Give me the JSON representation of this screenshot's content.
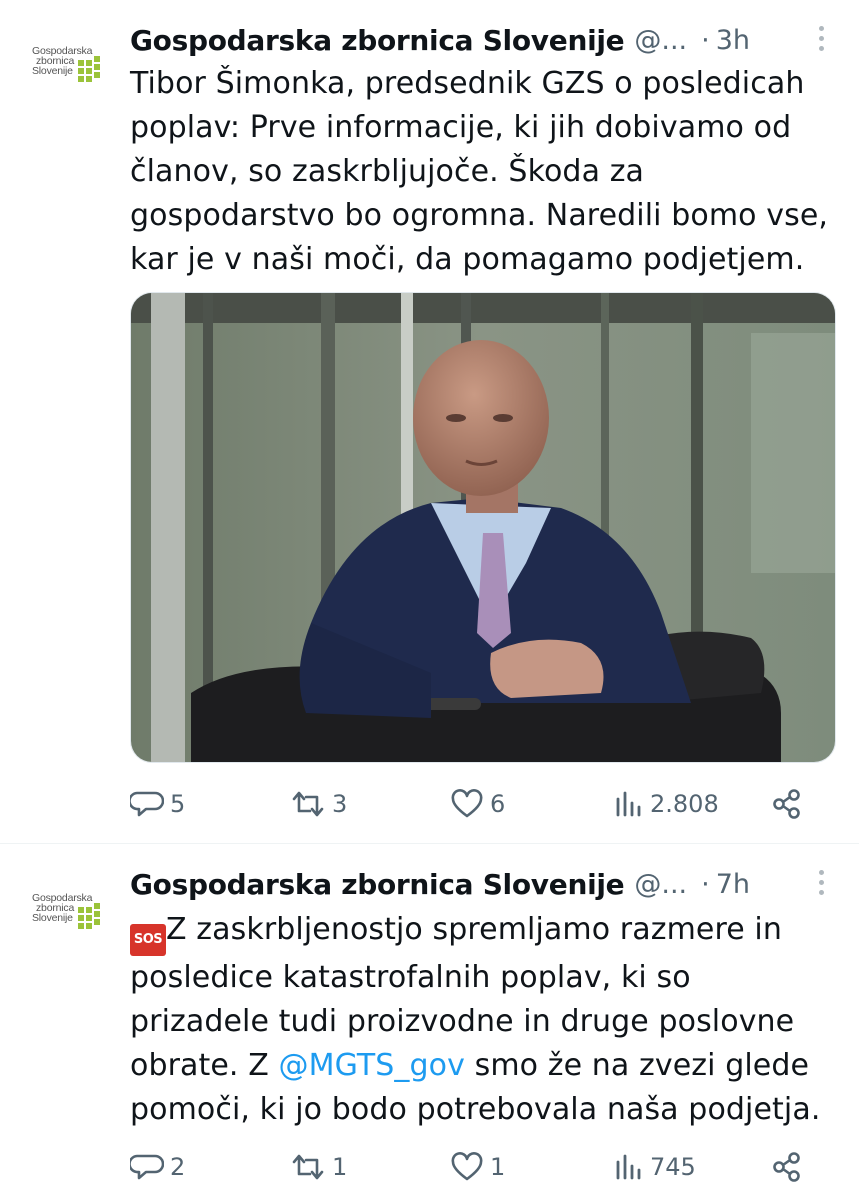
{
  "tweets": [
    {
      "author": "Gospodarska zbornica Slovenije",
      "handle": "@...",
      "separator": "·",
      "time": "3h",
      "logo_lines": [
        "Gospodarska",
        "zbornica",
        "Slovenije"
      ],
      "text": "Tibor Šimonka, predsednik GZS o posledicah poplav: Prve informacije, ki jih dobivamo od članov, so zaskrbljujoče. Škoda za gospodarstvo bo ogromna. Naredili bomo vse, kar je v naši moči, da pomagamo podjetjem.",
      "stats": {
        "replies": "5",
        "reposts": "3",
        "likes": "6",
        "views": "2.808"
      }
    },
    {
      "author": "Gospodarska zbornica Slovenije",
      "handle": "@...",
      "separator": "·",
      "time": "7h",
      "logo_lines": [
        "Gospodarska",
        "zbornica",
        "Slovenije"
      ],
      "sos_label": "SOS",
      "text_part1": "Z zaskrbljenostjo spremljamo razmere in posledice katastrofalnih poplav, ki so prizadele tudi proizvodne in druge poslovne obrate. Z ",
      "mention": "@MGTS_gov",
      "text_part2": " smo že na zvezi glede pomoči, ki jo bodo potrebovala naša podjetja.",
      "stats": {
        "replies": "2",
        "reposts": "1",
        "likes": "1",
        "views": "745"
      }
    }
  ],
  "colors": {
    "text": "#0f1419",
    "secondary": "#536471",
    "link": "#1d9bf0",
    "logo_green": "#9bc33a",
    "sos_red": "#d7342a"
  },
  "icons": [
    "reply-icon",
    "repost-icon",
    "like-icon",
    "views-icon",
    "share-icon",
    "more-icon"
  ]
}
